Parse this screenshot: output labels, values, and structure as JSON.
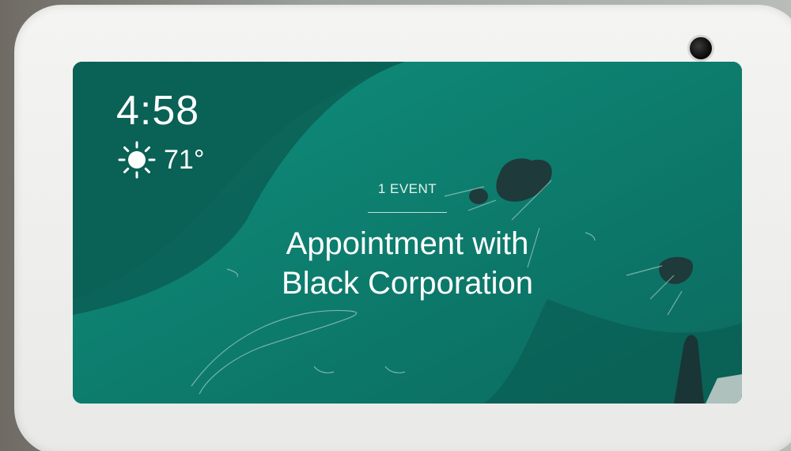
{
  "device": {
    "screen": {
      "clock": {
        "time": "4:58"
      },
      "weather": {
        "temperature": "71°",
        "condition_icon": "sun-icon"
      },
      "event": {
        "count_label": "1 EVENT",
        "title_line1": "Appointment with",
        "title_line2": "Black Corporation"
      }
    }
  },
  "colors": {
    "screen_bg_dark": "#0d6f63",
    "screen_bg_light": "#0f8f7d",
    "rock": "#1f3a3a",
    "text": "#ffffff",
    "device_shell": "#f2f2f0"
  }
}
